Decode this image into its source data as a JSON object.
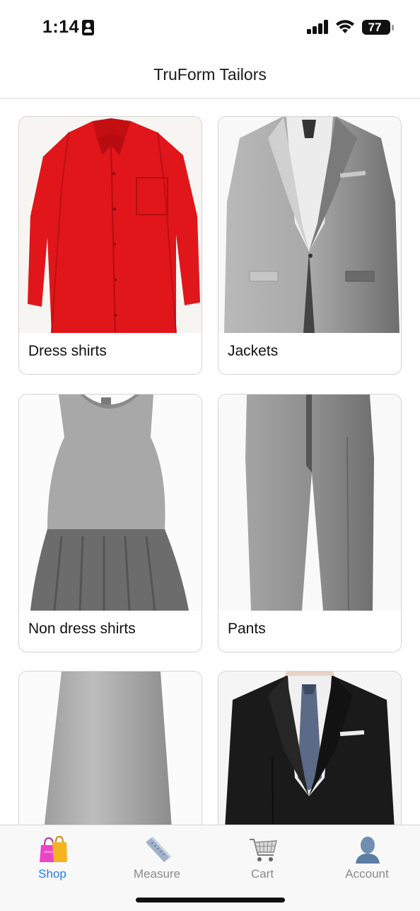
{
  "status_bar": {
    "time": "1:14",
    "battery": "77"
  },
  "header": {
    "title": "TruForm Tailors"
  },
  "categories": [
    {
      "label": "Dress shirts",
      "image": "red-dress-shirt"
    },
    {
      "label": "Jackets",
      "image": "grey-suit-jacket"
    },
    {
      "label": "Non dress shirts",
      "image": "grey-sleeveless-dress"
    },
    {
      "label": "Pants",
      "image": "grey-trousers"
    },
    {
      "label": "",
      "image": "grey-skirt"
    },
    {
      "label": "",
      "image": "black-suit-jacket"
    }
  ],
  "tab_bar": {
    "active": "Shop",
    "tabs": [
      {
        "label": "Shop",
        "icon": "shopping-bags-icon"
      },
      {
        "label": "Measure",
        "icon": "ruler-icon"
      },
      {
        "label": "Cart",
        "icon": "cart-icon"
      },
      {
        "label": "Account",
        "icon": "account-icon"
      }
    ]
  },
  "colors": {
    "accent": "#1e7ef0",
    "shirt_red": "#e0161a",
    "tab_inactive": "#8a8a8a"
  }
}
